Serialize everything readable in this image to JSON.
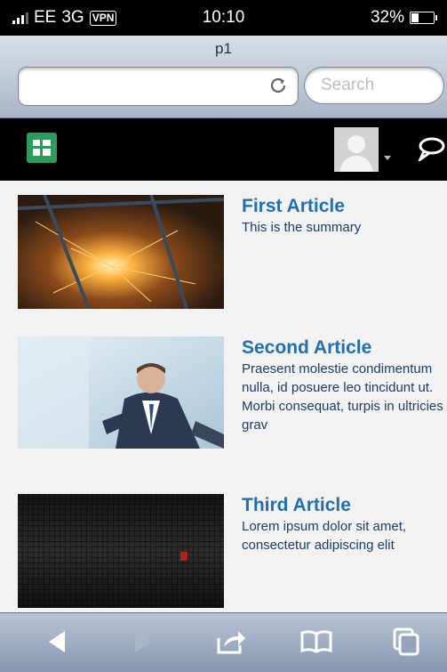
{
  "status_bar": {
    "carrier": "EE",
    "network": "3G",
    "vpn_label": "VPN",
    "time": "10:10",
    "battery_percent": "32%",
    "battery_level": 0.32
  },
  "browser": {
    "page_title": "p1",
    "url": "",
    "search_placeholder": "Search"
  },
  "articles": [
    {
      "title": "First Article",
      "summary": "This is the summary"
    },
    {
      "title": "Second Article",
      "summary": "Praesent molestie condimentum nulla, id posuere leo tincidunt ut. Morbi consequat, turpis in ultricies grav"
    },
    {
      "title": "Third Article",
      "summary": "Lorem ipsum dolor sit amet, consectetur adipiscing elit"
    }
  ],
  "toolbar": {
    "icons": [
      "back-icon",
      "forward-icon",
      "share-icon",
      "bookmarks-icon",
      "tabs-icon"
    ]
  },
  "colors": {
    "accent_green": "#2a9d5c",
    "article_title": "#1f6fb5",
    "article_text": "#1d3e66"
  }
}
